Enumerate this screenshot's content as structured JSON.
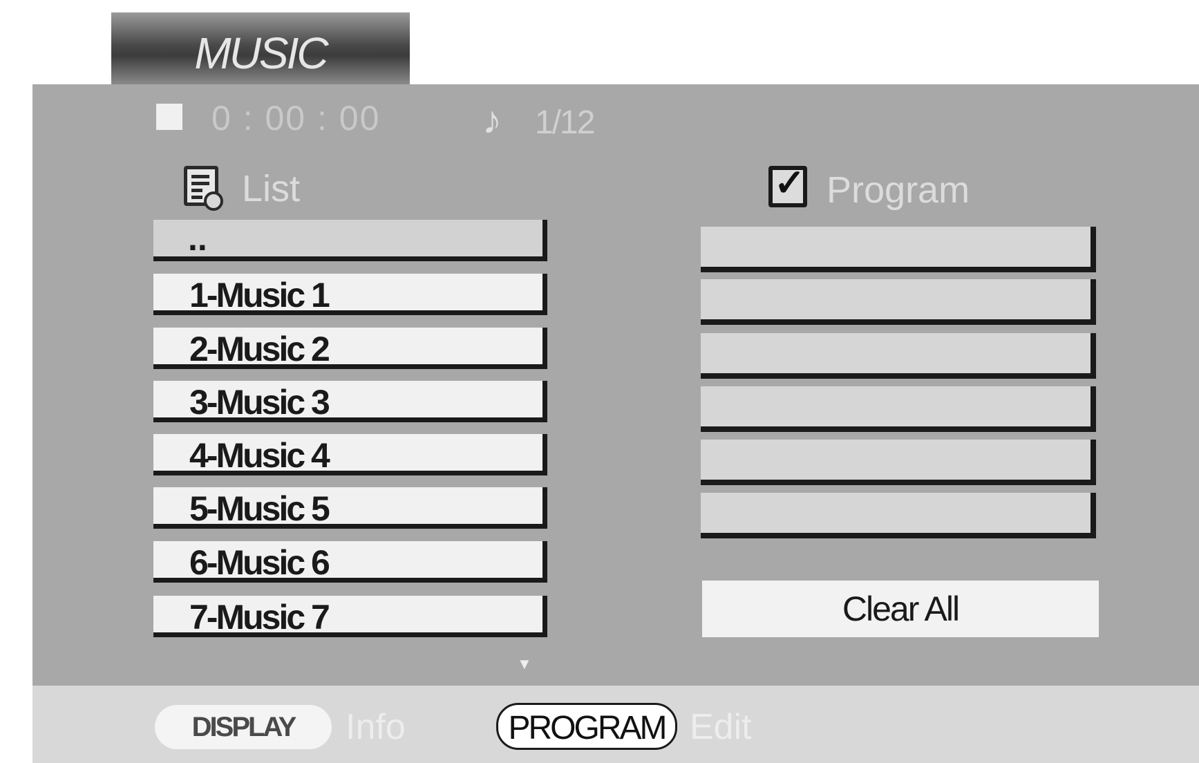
{
  "title": "MUSIC",
  "status": {
    "time": "0 : 00 : 00",
    "track": "1/12",
    "stop_icon": "stop-icon",
    "note_icon": "music-note-icon"
  },
  "list": {
    "label": "List",
    "icon": "playlist-disc-icon",
    "items": [
      "..",
      "1-Music 1",
      "2-Music 2",
      "3-Music 3",
      "4-Music 4",
      "5-Music 5",
      "6-Music 6",
      "7-Music 7"
    ],
    "more_icon": "scroll-down-arrow-icon"
  },
  "program": {
    "label": "Program",
    "icon": "checkbox-checked-icon",
    "slots": [
      "",
      "",
      "",
      "",
      "",
      ""
    ],
    "clear_all": "Clear All"
  },
  "footer": {
    "display_button": "DISPLAY",
    "display_hint": "Info",
    "program_button": "PROGRAM",
    "program_hint": "Edit"
  }
}
